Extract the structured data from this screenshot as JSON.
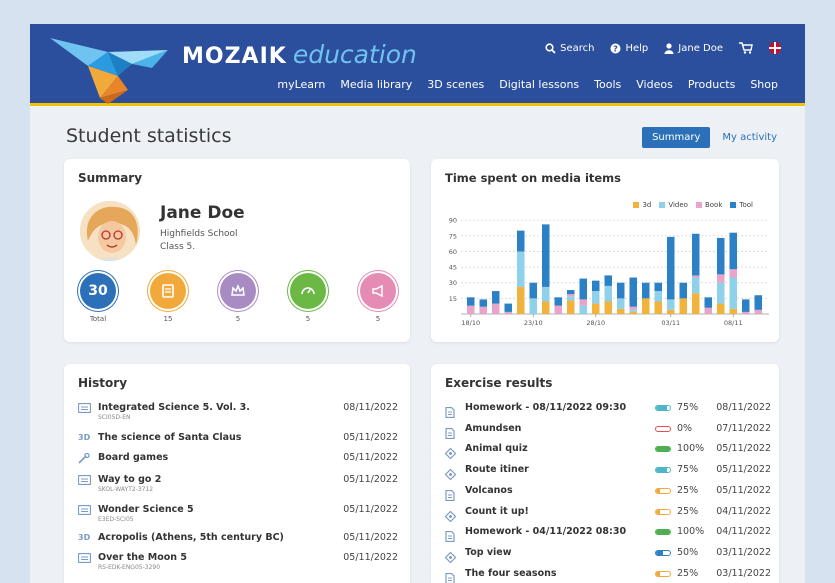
{
  "brand": {
    "name": "MOZAIK",
    "suffix": "education"
  },
  "topbar": {
    "search": "Search",
    "help": "Help",
    "user": "Jane Doe"
  },
  "nav": [
    "myLearn",
    "Media library",
    "3D scenes",
    "Digital lessons",
    "Tools",
    "Videos",
    "Products",
    "Shop"
  ],
  "page": {
    "title": "Student statistics"
  },
  "tabs": {
    "summary": "Summary",
    "activity": "My activity"
  },
  "summary": {
    "title": "Summary",
    "name": "Jane Doe",
    "school": "Highfields School",
    "class": "Class 5.",
    "stats": [
      {
        "value": "30",
        "label": "Total",
        "color": "#2b70b8"
      },
      {
        "value": "",
        "label": "15",
        "color": "#f2a93b"
      },
      {
        "value": "",
        "label": "5",
        "color": "#a98bc4"
      },
      {
        "value": "",
        "label": "5",
        "color": "#6bb845"
      },
      {
        "value": "",
        "label": "5",
        "color": "#e48cb4"
      }
    ]
  },
  "chart_title": "Time spent on media items",
  "chart_data": {
    "type": "bar",
    "stacked": true,
    "legend": [
      "3d",
      "Video",
      "Book",
      "Tool"
    ],
    "colors": [
      "#f2b33d",
      "#8fd0ea",
      "#e8a4c9",
      "#2b80c6"
    ],
    "x_ticks": [
      {
        "index": 0,
        "label": "18/10"
      },
      {
        "index": 5,
        "label": "23/10"
      },
      {
        "index": 10,
        "label": "28/10"
      },
      {
        "index": 16,
        "label": "03/11"
      },
      {
        "index": 21,
        "label": "08/11"
      }
    ],
    "y_ticks": [
      15,
      30,
      45,
      60,
      75,
      90
    ],
    "ylim": [
      0,
      95
    ],
    "bars": [
      [
        0,
        0,
        8,
        8
      ],
      [
        0,
        0,
        7,
        7
      ],
      [
        0,
        0,
        10,
        12
      ],
      [
        0,
        0,
        2,
        8
      ],
      [
        26,
        34,
        0,
        20
      ],
      [
        0,
        15,
        0,
        15
      ],
      [
        12,
        14,
        0,
        60
      ],
      [
        0,
        0,
        8,
        8
      ],
      [
        13,
        4,
        2,
        4
      ],
      [
        0,
        8,
        6,
        20
      ],
      [
        10,
        12,
        0,
        10
      ],
      [
        12,
        15,
        0,
        10
      ],
      [
        5,
        10,
        0,
        15
      ],
      [
        2,
        2,
        3,
        28
      ],
      [
        15,
        0,
        0,
        15
      ],
      [
        12,
        10,
        0,
        8
      ],
      [
        4,
        10,
        0,
        60
      ],
      [
        15,
        0,
        0,
        15
      ],
      [
        20,
        15,
        2,
        40
      ],
      [
        0,
        0,
        6,
        10
      ],
      [
        10,
        20,
        8,
        35
      ],
      [
        5,
        30,
        8,
        35
      ],
      [
        0,
        0,
        2,
        12
      ],
      [
        0,
        0,
        4,
        14
      ]
    ]
  },
  "history": {
    "title": "History",
    "items": [
      {
        "name": "Integrated Science 5. Vol. 3.",
        "code": "SCI05D-EN",
        "date": "08/11/2022",
        "icon": "book"
      },
      {
        "name": "The science of Santa Claus",
        "code": "",
        "date": "05/11/2022",
        "icon": "3d"
      },
      {
        "name": "Board games",
        "code": "",
        "date": "05/11/2022",
        "icon": "tool"
      },
      {
        "name": "Way to go 2",
        "code": "SKOL-WAYT2-3712",
        "date": "05/11/2022",
        "icon": "book"
      },
      {
        "name": "Wonder Science 5",
        "code": "E3ED-SCI05",
        "date": "05/11/2022",
        "icon": "book"
      },
      {
        "name": "Acropolis (Athens, 5th century BC)",
        "code": "",
        "date": "05/11/2022",
        "icon": "3d"
      },
      {
        "name": "Over the Moon 5",
        "code": "RS-EDK-ENG05-3290",
        "date": "05/11/2022",
        "icon": "book"
      }
    ]
  },
  "exercises": {
    "title": "Exercise results",
    "items": [
      {
        "name": "Homework - 08/11/2022 09:30",
        "pct": "75%",
        "fill": 0.75,
        "color": "#4bb7c9",
        "date": "08/11/2022",
        "icon": "doc"
      },
      {
        "name": "Amundsen",
        "pct": "0%",
        "fill": 0,
        "color": "#e05050",
        "date": "07/11/2022",
        "icon": "doc"
      },
      {
        "name": "Animal quiz",
        "pct": "100%",
        "fill": 1,
        "color": "#4caf50",
        "date": "05/11/2022",
        "icon": "quiz"
      },
      {
        "name": "Route itiner",
        "pct": "75%",
        "fill": 0.75,
        "color": "#4bb7c9",
        "date": "05/11/2022",
        "icon": "quiz"
      },
      {
        "name": "Volcanos",
        "pct": "25%",
        "fill": 0.25,
        "color": "#f2a93b",
        "date": "05/11/2022",
        "icon": "doc"
      },
      {
        "name": "Count it up!",
        "pct": "25%",
        "fill": 0.25,
        "color": "#f2a93b",
        "date": "04/11/2022",
        "icon": "quiz"
      },
      {
        "name": "Homework - 04/11/2022 08:30",
        "pct": "100%",
        "fill": 1,
        "color": "#4caf50",
        "date": "04/11/2022",
        "icon": "doc"
      },
      {
        "name": "Top view",
        "pct": "50%",
        "fill": 0.5,
        "color": "#2b80c6",
        "date": "03/11/2022",
        "icon": "quiz"
      },
      {
        "name": "The four seasons",
        "pct": "25%",
        "fill": 0.25,
        "color": "#f2a93b",
        "date": "03/11/2022",
        "icon": "doc"
      }
    ]
  }
}
